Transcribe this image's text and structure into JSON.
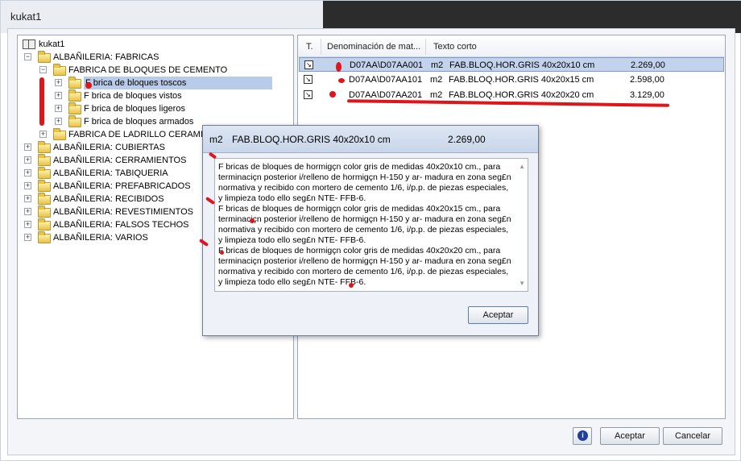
{
  "window": {
    "title": "kukat1"
  },
  "tree": {
    "root_label": "kukat1",
    "items": [
      {
        "label": "ALBAÑILERIA: FABRICAS",
        "expander": "−"
      },
      {
        "label": "FABRICA DE BLOQUES DE CEMENTO",
        "expander": "−"
      },
      {
        "label": "F brica de bloques toscos",
        "expander": "+",
        "selected": true
      },
      {
        "label": "F brica de bloques vistos",
        "expander": "+"
      },
      {
        "label": "F brica de bloques ligeros",
        "expander": "+"
      },
      {
        "label": "F brica de bloques armados",
        "expander": "+"
      },
      {
        "label": "FABRICA DE LADRILLO CERAMICO",
        "expander": "+"
      },
      {
        "label": "ALBAÑILERIA: CUBIERTAS",
        "expander": "+"
      },
      {
        "label": "ALBAÑILERIA: CERRAMIENTOS",
        "expander": "+"
      },
      {
        "label": "ALBAÑILERIA: TABIQUERIA",
        "expander": "+"
      },
      {
        "label": "ALBAÑILERIA: PREFABRICADOS",
        "expander": "+"
      },
      {
        "label": "ALBAÑILERIA: RECIBIDOS",
        "expander": "+"
      },
      {
        "label": "ALBAÑILERIA: REVESTIMIENTOS",
        "expander": "+"
      },
      {
        "label": "ALBAÑILERIA: FALSOS TECHOS",
        "expander": "+"
      },
      {
        "label": "ALBAÑILERIA: VARIOS",
        "expander": "+"
      }
    ]
  },
  "list": {
    "columns": [
      "T.",
      "Denominación de mat...",
      "Texto corto"
    ],
    "rows": [
      {
        "code": "D07AA\\D07AA001",
        "unit": "m2",
        "text": "FAB.BLOQ.HOR.GRIS 40x20x10 cm",
        "price": "2.269,00"
      },
      {
        "code": "D07AA\\D07AA101",
        "unit": "m2",
        "text": "FAB.BLOQ.HOR.GRIS 40x20x15 cm",
        "price": "2.598,00"
      },
      {
        "code": "D07AA\\D07AA201",
        "unit": "m2",
        "text": "FAB.BLOQ.HOR.GRIS 40x20x20 cm",
        "price": "3.129,00"
      }
    ]
  },
  "popup": {
    "unit": "m2",
    "title": "FAB.BLOQ.HOR.GRIS 40x20x10 cm",
    "price": "2.269,00",
    "paragraphs": [
      "F bricas  de  bloques de hormigçn color gris de  medidas  40x20x10  cm., para  terminaciçn posterior  i/relleno de hormigçn H-150 y ar- madura  en  zona  seg£n normativa y recibido con mortero de cemento 1/6, i/p.p. de piezas  especiales,  y limpieza todo ello seg£n NTE- FFB-6.",
      "F bricas  de  bloques de hormigçn color gris de  medidas  40x20x15  cm., para  terminaciçn posterior  i/relleno de hormigçn H-150 y ar- madura  en  zona  seg£n normativa y recibido con mortero de cemento 1/6, i/p.p. de piezas  especiales,  y limpieza todo ello seg£n NTE- FFB-6.",
      "F bricas  de  bloques de hormigçn color gris de  medidas  40x20x20  cm., para  terminaciçn posterior  i/relleno de hormigçn H-150 y ar- madura  en  zona  seg£n normativa y recibido con mortero de cemento 1/6, i/p.p. de piezas  especiales,  y limpieza todo ello seg£n NTE- FFB-6."
    ],
    "accept_label": "Aceptar"
  },
  "footer": {
    "accept_label": "Aceptar",
    "cancel_label": "Cancelar",
    "info_glyph": "i"
  },
  "colors": {
    "selection": "#c3d3ee",
    "annotation": "#e0141b"
  }
}
